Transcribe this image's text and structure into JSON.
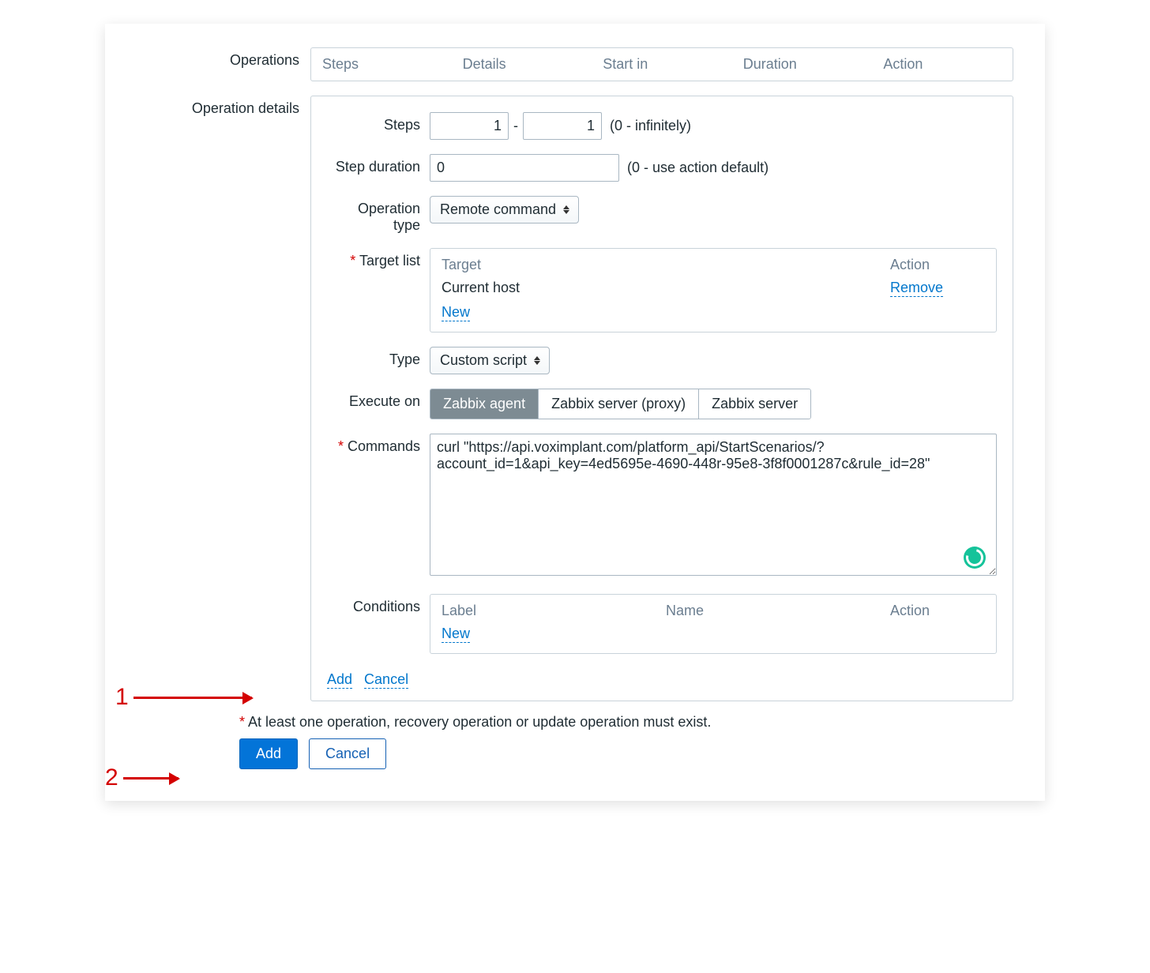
{
  "operations": {
    "label": "Operations",
    "columns": [
      "Steps",
      "Details",
      "Start in",
      "Duration",
      "Action"
    ]
  },
  "details": {
    "section_label": "Operation details",
    "steps": {
      "label": "Steps",
      "from": "1",
      "to": "1",
      "hint": "(0 - infinitely)"
    },
    "step_duration": {
      "label": "Step duration",
      "value": "0",
      "hint": "(0 - use action default)"
    },
    "operation_type": {
      "label": "Operation type",
      "value": "Remote command"
    },
    "target_list": {
      "label": "Target list",
      "head_target": "Target",
      "head_action": "Action",
      "row_target": "Current host",
      "row_action": "Remove",
      "new": "New"
    },
    "type": {
      "label": "Type",
      "value": "Custom script"
    },
    "execute_on": {
      "label": "Execute on",
      "options": [
        "Zabbix agent",
        "Zabbix server (proxy)",
        "Zabbix server"
      ],
      "active": 0
    },
    "commands": {
      "label": "Commands",
      "value": "curl \"https://api.voximplant.com/platform_api/StartScenarios/?account_id=1&api_key=4ed5695e-4690-448r-95e8-3f8f0001287c&rule_id=28\""
    },
    "conditions": {
      "label": "Conditions",
      "head_label": "Label",
      "head_name": "Name",
      "head_action": "Action",
      "new": "New"
    },
    "bottom": {
      "add": "Add",
      "cancel": "Cancel"
    }
  },
  "note": "At least one operation, recovery operation or update operation must exist.",
  "buttons": {
    "add": "Add",
    "cancel": "Cancel"
  },
  "annotations": {
    "one": "1",
    "two": "2"
  }
}
